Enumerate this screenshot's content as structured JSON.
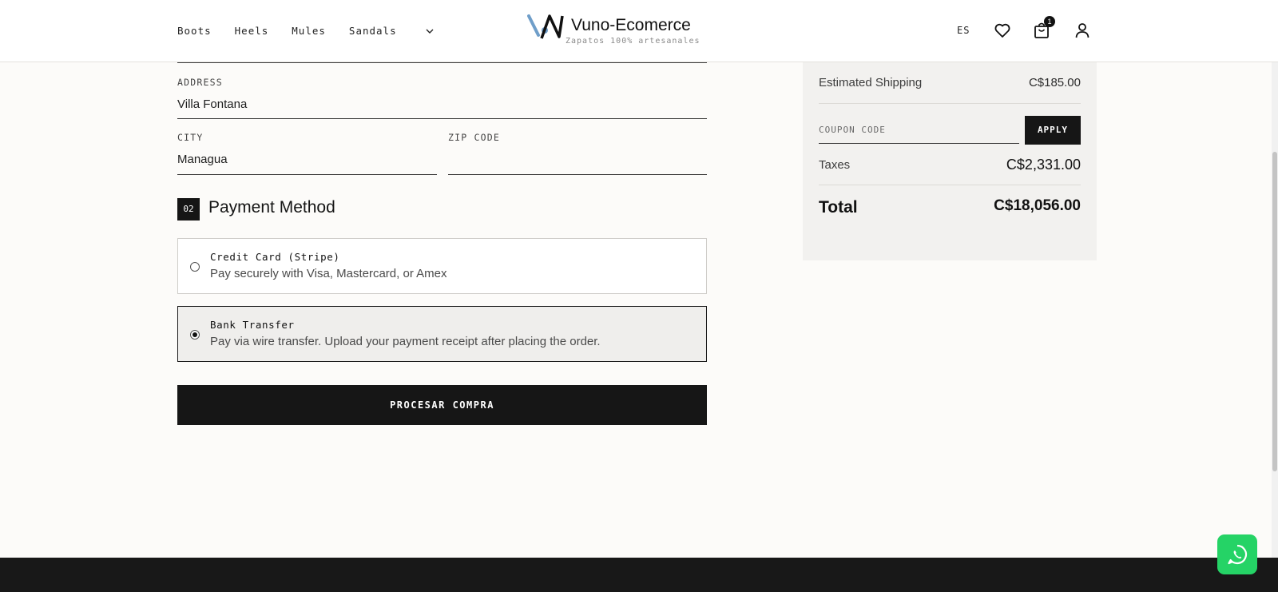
{
  "header": {
    "nav": [
      "Boots",
      "Heels",
      "Mules",
      "Sandals"
    ],
    "brand_name": "Vuno-Ecomerce",
    "brand_tagline": "Zapatos 100% artesanales",
    "language": "ES",
    "cart_count": "1"
  },
  "form": {
    "address": {
      "label": "ADDRESS",
      "value": "Villa Fontana"
    },
    "city": {
      "label": "CITY",
      "value": "Managua"
    },
    "zip": {
      "label": "ZIP CODE",
      "value": ""
    }
  },
  "payment": {
    "step_number": "02",
    "title": "Payment Method",
    "options": [
      {
        "title": "Credit Card (Stripe)",
        "description": "Pay securely with Visa, Mastercard, or Amex",
        "selected": false
      },
      {
        "title": "Bank Transfer",
        "description": "Pay via wire transfer. Upload your payment receipt after placing the order.",
        "selected": true
      }
    ],
    "submit_label": "PROCESAR COMPRA"
  },
  "summary": {
    "shipping_label": "Estimated Shipping",
    "shipping_value": "C$185.00",
    "coupon_placeholder": "COUPON CODE",
    "apply_label": "APPLY",
    "taxes_label": "Taxes",
    "taxes_value": "C$2,331.00",
    "total_label": "Total",
    "total_value": "C$18,056.00"
  },
  "colors": {
    "accent": "#161616",
    "page_background": "#fcfbf9",
    "panel_background": "#f2f1ef",
    "whatsapp": "#25d366",
    "logo_blue": "#6f9ec9"
  }
}
